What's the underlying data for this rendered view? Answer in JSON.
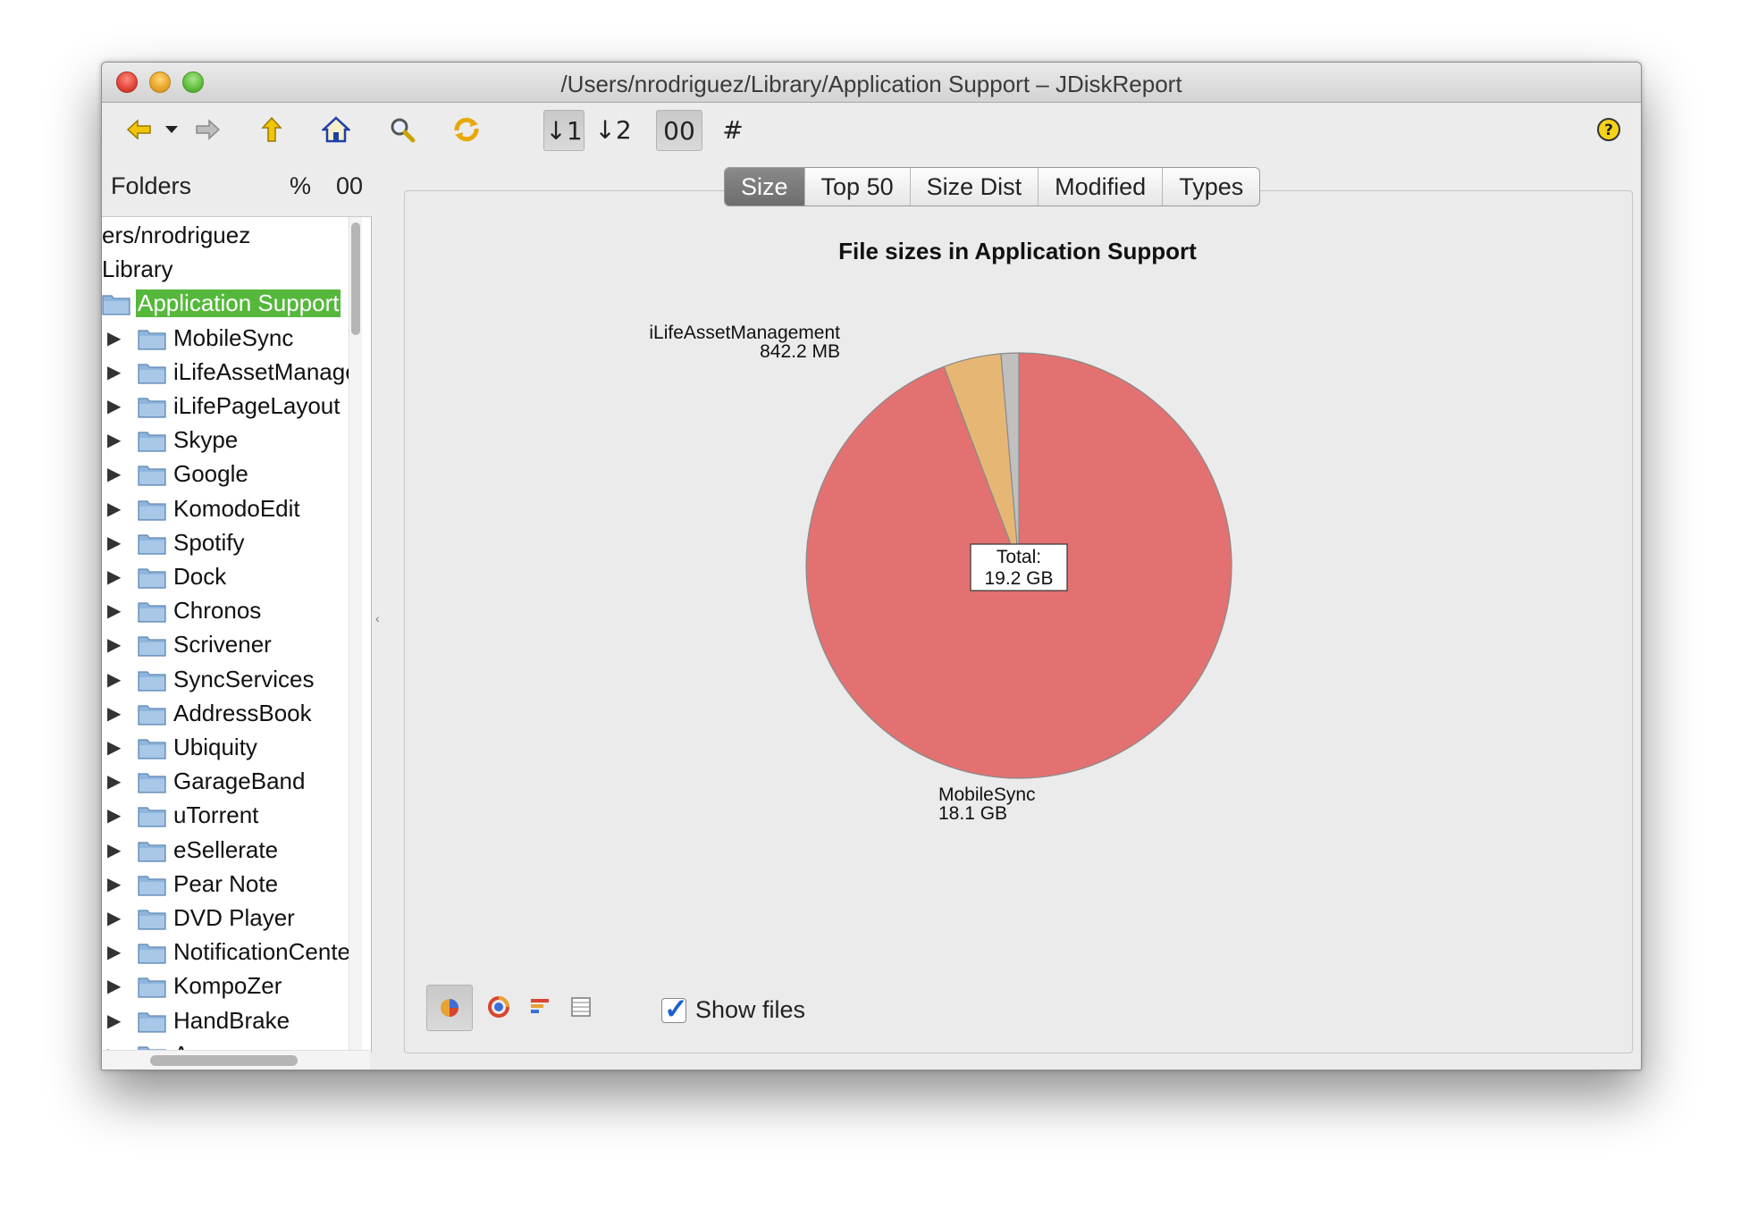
{
  "window": {
    "title": "/Users/nrodriguez/Library/Application Support – JDiskReport"
  },
  "toolbar": {
    "icons": [
      "back-icon",
      "back-menu-icon",
      "forward-icon",
      "up-icon",
      "home-icon",
      "search-icon",
      "refresh-icon",
      "sort-desc-icon",
      "sort-asc-icon",
      "size-units-icon",
      "count-icon",
      "help-icon"
    ],
    "sort_desc_label": "↓1",
    "sort_asc_label": "↓2",
    "units_label": "00",
    "count_label": "#",
    "help_label": "?"
  },
  "sidebar": {
    "header": {
      "label": "Folders",
      "percent": "%",
      "units": "00"
    },
    "path_rows": [
      "ers/nrodriguez",
      "Library"
    ],
    "selected": "Application Support",
    "items": [
      "MobileSync",
      "iLifeAssetManage",
      "iLifePageLayout",
      "Skype",
      "Google",
      "KomodoEdit",
      "Spotify",
      "Dock",
      "Chronos",
      "Scrivener",
      "SyncServices",
      "AddressBook",
      "Ubiquity",
      "GarageBand",
      "uTorrent",
      "eSellerate",
      "Pear Note",
      "DVD Player",
      "NotificationCente",
      "KompoZer",
      "HandBrake"
    ],
    "partial_last": "A"
  },
  "tabs": [
    {
      "label": "Size",
      "active": true
    },
    {
      "label": "Top 50",
      "active": false
    },
    {
      "label": "Size Dist",
      "active": false
    },
    {
      "label": "Modified",
      "active": false
    },
    {
      "label": "Types",
      "active": false
    }
  ],
  "chart_data": {
    "type": "pie",
    "title": "File sizes in Application Support",
    "total_label": "Total:",
    "total_value": "19.2 GB",
    "slices": [
      {
        "name": "MobileSync",
        "value_gb": 18.1,
        "label": "18.1 GB",
        "color": "#e37171"
      },
      {
        "name": "iLifeAssetManagement",
        "value_gb": 0.8422,
        "label": "842.2 MB",
        "color": "#e6b774"
      },
      {
        "name": "",
        "value_gb": 0.2578,
        "label": "",
        "color": "#c0c0c0"
      }
    ]
  },
  "bottom": {
    "view_icons": [
      "pie-chart-icon",
      "ring-chart-icon",
      "bar-chart-icon",
      "table-icon"
    ],
    "show_files_label": "Show files",
    "show_files_checked": true
  },
  "colors": {
    "selection": "#55b83b",
    "folder_blue": "#8fb5dc"
  }
}
